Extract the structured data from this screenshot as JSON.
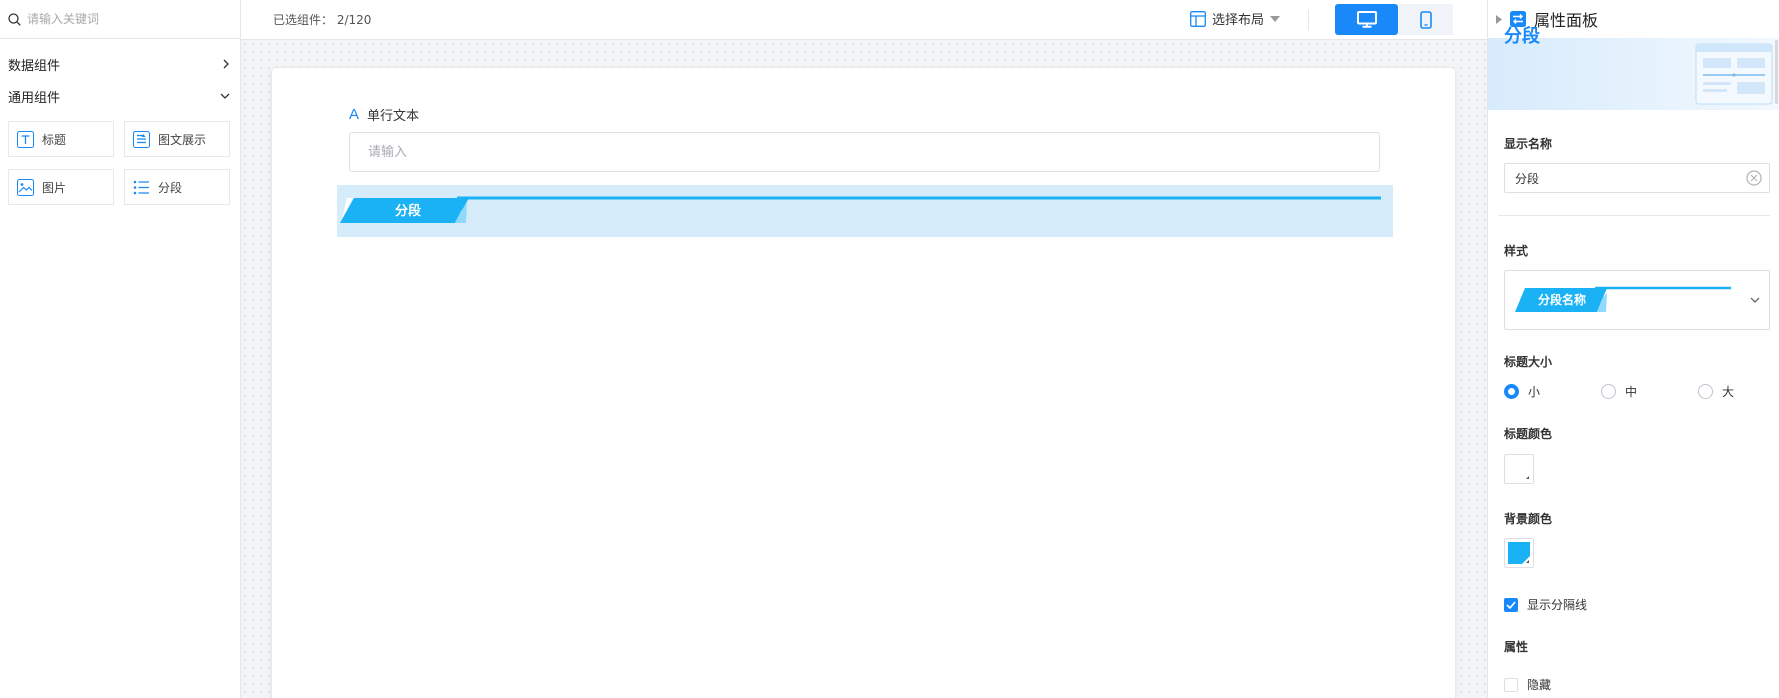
{
  "search": {
    "placeholder": "请输入关键词"
  },
  "left_panel": {
    "groups": [
      {
        "label": "数据组件",
        "chevron": "chevron-right"
      },
      {
        "label": "通用组件",
        "chevron": "chevron-down"
      }
    ],
    "components": [
      {
        "label": "标题",
        "icon": "title-icon"
      },
      {
        "label": "图文展示",
        "icon": "image-text-icon"
      },
      {
        "label": "图片",
        "icon": "image-icon"
      },
      {
        "label": "分段",
        "icon": "list-icon"
      }
    ]
  },
  "topbar": {
    "selected_label": "已选组件：",
    "selected_value": "2/120",
    "layout_label": "选择布局",
    "accent_color": "#1989fa"
  },
  "canvas": {
    "field_label": "单行文本",
    "field_placeholder": "请输入",
    "section_title": "分段",
    "section_color": "#1ab2f5",
    "section_bg": "#d7ecfb"
  },
  "right_panel": {
    "title": "属性面板",
    "banner_title": "分段",
    "display_name_label": "显示名称",
    "display_name_value": "分段",
    "style_label": "样式",
    "style_preview_text": "分段名称",
    "title_size_label": "标题大小",
    "title_size_options": [
      "小",
      "中",
      "大"
    ],
    "title_size_selected": "小",
    "title_color_label": "标题颜色",
    "bg_color_label": "背景颜色",
    "bg_color_value": "#1ab2f5",
    "show_divider_label": "显示分隔线",
    "show_divider_checked": true,
    "attrs_label": "属性",
    "hidden_label": "隐藏",
    "hidden_checked": false
  }
}
